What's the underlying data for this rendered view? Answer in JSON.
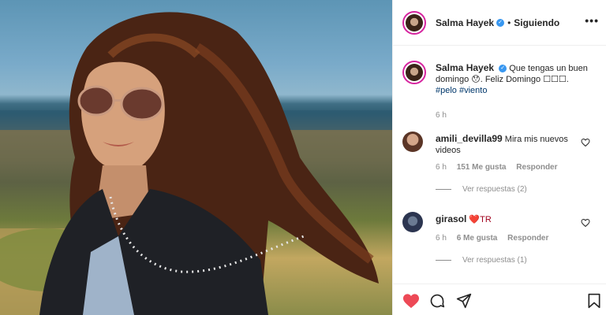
{
  "post": {
    "username": "Salma Hayek",
    "follow_label": "Siguiendo",
    "more_label": "•••",
    "caption": {
      "text_line1": "Que tengas un buen",
      "text_line2": "domingo 😯. Feliz Domingo ☐☐☐.",
      "hashtags": "#pelo #viento",
      "time": "6 h"
    },
    "comments": [
      {
        "username": "amili_devilla99",
        "text": "Mira mis nuevos videos",
        "time": "6 h",
        "likes": "151 Me gusta",
        "reply_label": "Responder",
        "view_replies": "Ver respuestas (2)"
      },
      {
        "username": "girasol",
        "text": "❤️TR",
        "time": "6 h",
        "likes": "6 Me gusta",
        "reply_label": "Responder",
        "view_replies": "Ver respuestas (1)"
      }
    ],
    "colors": {
      "like_red": "#ed4956",
      "verified_blue": "#3897f0",
      "link_blue": "#00376b",
      "meta_gray": "#8e8e8e"
    },
    "icons": [
      "heart-filled-icon",
      "comment-icon",
      "share-icon",
      "bookmark-icon",
      "heart-outline-icon"
    ]
  }
}
